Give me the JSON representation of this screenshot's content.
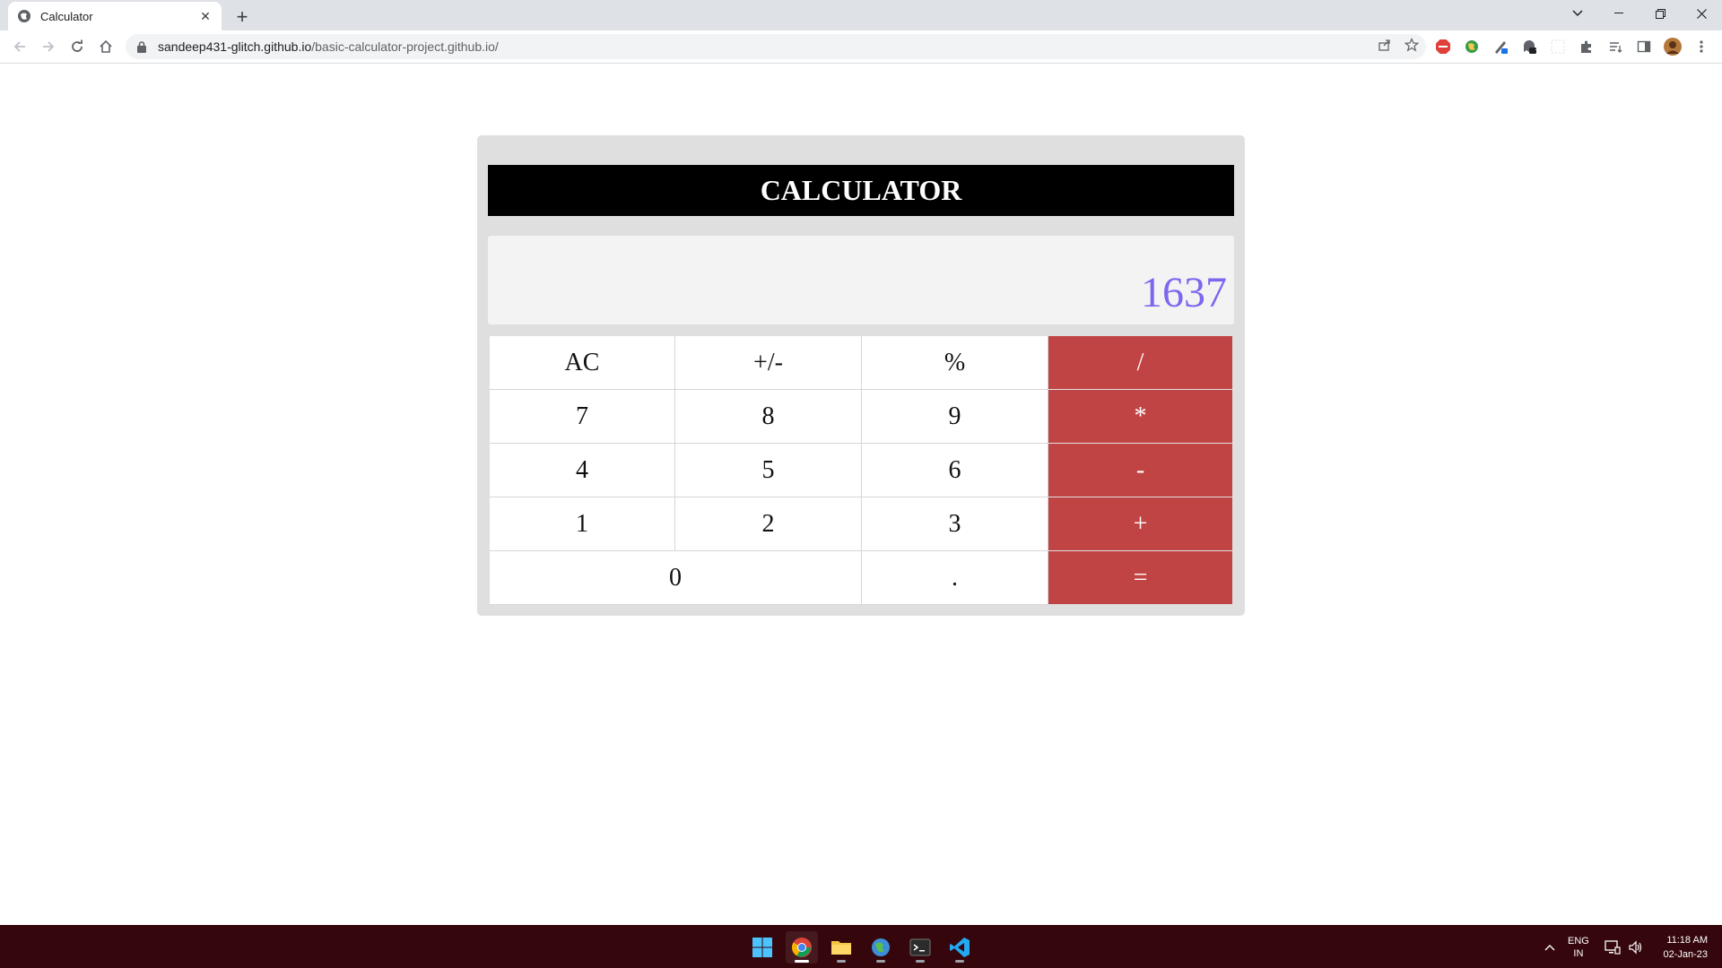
{
  "browser": {
    "tab_title": "Calculator",
    "url_host": "sandeep431-glitch.github.io",
    "url_path": "/basic-calculator-project.github.io/",
    "extension_badge": "7"
  },
  "calculator": {
    "title": "CALCULATOR",
    "display_value": "1637",
    "keys": {
      "ac": "AC",
      "sign": "+/-",
      "percent": "%",
      "divide": "/",
      "seven": "7",
      "eight": "8",
      "nine": "9",
      "multiply": "*",
      "four": "4",
      "five": "5",
      "six": "6",
      "subtract": "-",
      "one": "1",
      "two": "2",
      "three": "3",
      "add": "+",
      "zero": "0",
      "decimal": ".",
      "equals": "="
    },
    "colors": {
      "operator_bg": "#c14444",
      "display_text": "#7b68ee",
      "header_bg": "#000000"
    }
  },
  "taskbar": {
    "lang_line1": "ENG",
    "lang_line2": "IN",
    "time": "11:18 AM",
    "date": "02-Jan-23"
  }
}
